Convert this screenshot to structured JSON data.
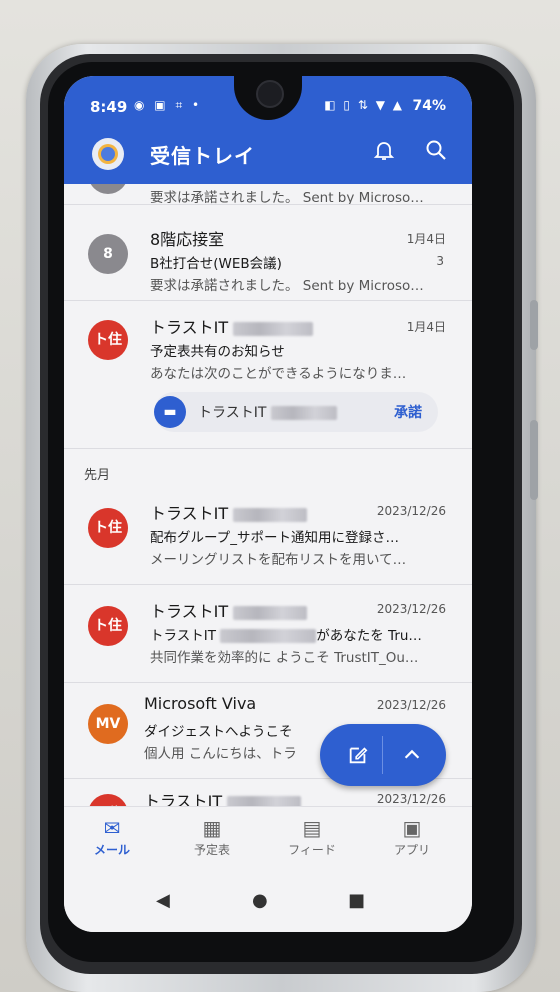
{
  "status_bar": {
    "time": "8:49",
    "left_icons": "◉ ▣ ⌗ •",
    "right_icons": "◧ ▯ ⇅ ▼ ▲",
    "battery": "74%"
  },
  "app_bar": {
    "title": "受信トレイ",
    "bell_icon": "bell-icon",
    "search_icon": "search-icon"
  },
  "messages": [
    {
      "avatar": "",
      "sender": "",
      "date": "",
      "subject": "",
      "count": "",
      "preview": "要求は承諾されました。 Sent by Microso…"
    },
    {
      "avatar": "8",
      "avatar_color": "#8a898e",
      "sender": "8階応接室",
      "date": "1月4日",
      "subject": "B社打合せ(WEB会議)",
      "count": "3",
      "preview": "要求は承諾されました。 Sent by Microso…"
    },
    {
      "avatar": "ト住",
      "avatar_color": "#d9362b",
      "sender": "トラストIT",
      "date": "1月4日",
      "subject": "予定表共有のお知らせ",
      "count": "",
      "preview": "あなたは次のことができるようになりま…"
    },
    {
      "avatar": "ト住",
      "avatar_color": "#d9362b",
      "sender": "トラストIT",
      "date": "2023/12/26",
      "subject": "配布グループ_サポート通知用に登録さ…",
      "count": "",
      "preview": "メーリングリストを配布リストを用いて…"
    },
    {
      "avatar": "ト住",
      "avatar_color": "#d9362b",
      "sender": "トラストIT",
      "date": "2023/12/26",
      "subject_a": "トラストIT",
      "subject_b": "があなたを Tru…",
      "count": "",
      "preview": "共同作業を効率的に ようこそ TrustIT_Ou…"
    },
    {
      "avatar": "MV",
      "avatar_color": "#e06b1f",
      "sender": "Microsoft Viva",
      "date": "2023/12/26",
      "subject": "ダイジェストへようこそ",
      "count": "",
      "preview": "個人用 こんにちは、トラ"
    },
    {
      "avatar": "ト住",
      "avatar_color": "#d9362b",
      "sender": "トラストIT",
      "date": "2023/12/26",
      "subject": "",
      "count": "",
      "preview": ""
    }
  ],
  "invite_pill": {
    "name": "トラストIT",
    "accept": "承諾"
  },
  "section_last_month": "先月",
  "bottom_nav": [
    {
      "label": "メール",
      "icon": "✉"
    },
    {
      "label": "予定表",
      "icon": "▦"
    },
    {
      "label": "フィード",
      "icon": "▤"
    },
    {
      "label": "アプリ",
      "icon": "▣"
    }
  ],
  "fab": {
    "compose_icon": "✎",
    "up_icon": "⌃"
  },
  "system_nav": {
    "back": "◀",
    "home": "●",
    "recents": "■"
  },
  "colors": {
    "accent": "#2e5fd0",
    "red_avatar": "#d9362b",
    "orange_avatar": "#e06b1f",
    "grey_avatar": "#8a898e"
  }
}
